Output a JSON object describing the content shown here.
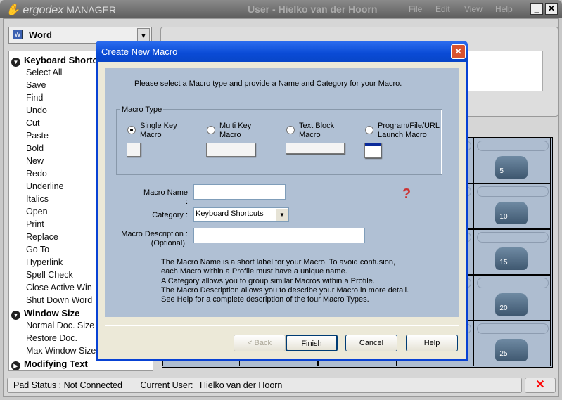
{
  "app": {
    "brand": "ergodex",
    "brand_suffix": "MANAGER",
    "user_title": "User - Hielko van der Hoorn",
    "menu": [
      "File",
      "Edit",
      "View",
      "Help"
    ]
  },
  "profile": {
    "selected": "Word"
  },
  "sidebar": {
    "groups": [
      {
        "label": "Keyboard Shortcuts",
        "expanded": true,
        "items": [
          "Select All",
          "Save",
          "Find",
          "Undo",
          "Cut",
          "Paste",
          "Bold",
          "New",
          "Redo",
          "Underline",
          "Italics",
          "Open",
          "Print",
          "Replace",
          "Go To",
          "Hyperlink",
          "Spell Check",
          "Close Active Win",
          "Shut Down Word"
        ]
      },
      {
        "label": "Window Size",
        "expanded": true,
        "items": [
          "Normal Doc. Size",
          "Restore Doc.",
          "Max Window Size"
        ]
      },
      {
        "label": "Modifying Text",
        "expanded": false,
        "items": []
      }
    ]
  },
  "keys": [
    "5",
    "10",
    "15",
    "20",
    "25"
  ],
  "status": {
    "pad": "Pad Status : Not Connected",
    "user_label": "Current User:",
    "user": "Hielko van der Hoorn"
  },
  "dialog": {
    "title": "Create New Macro",
    "intro": "Please select a Macro type and provide a Name and Category for your Macro.",
    "macro_type_label": "Macro Type",
    "types": [
      {
        "line1": "Single Key",
        "line2": "Macro",
        "selected": true
      },
      {
        "line1": "Multi Key",
        "line2": "Macro",
        "selected": false
      },
      {
        "line1": "Text Block",
        "line2": "Macro",
        "selected": false
      },
      {
        "line1": "Program/File/URL",
        "line2": "Launch Macro",
        "selected": false
      }
    ],
    "name_label": "Macro Name :",
    "name_value": "",
    "category_label": "Category :",
    "category_value": "Keyboard Shortcuts",
    "desc_label": "Macro Description :",
    "desc_optional": "(Optional)",
    "desc_value": "",
    "help_lines": [
      "The Macro Name is a short label for your Macro.  To avoid confusion,",
      "each Macro within a Profile must have a unique name.",
      "A Category allows you to group similar Macros within a Profile.",
      "The Macro Description allows you to describe your Macro in more detail.",
      "See Help for a complete description of the four Macro Types."
    ],
    "buttons": {
      "back": "< Back",
      "finish": "Finish",
      "cancel": "Cancel",
      "help": "Help"
    }
  }
}
